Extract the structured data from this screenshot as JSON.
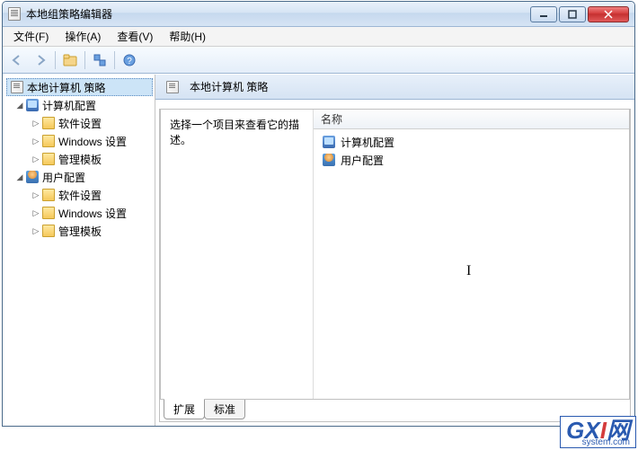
{
  "window_title": "本地组策略编辑器",
  "menus": {
    "file": "文件(F)",
    "action": "操作(A)",
    "view": "查看(V)",
    "help": "帮助(H)"
  },
  "tree": {
    "root": "本地计算机 策略",
    "computer": "计算机配置",
    "user": "用户配置",
    "software": "软件设置",
    "windows": "Windows 设置",
    "admin": "管理模板"
  },
  "header_title": "本地计算机 策略",
  "description_prompt": "选择一个项目来查看它的描述。",
  "list_header_name": "名称",
  "list_items": {
    "computer": "计算机配置",
    "user": "用户配置"
  },
  "tabs": {
    "extended": "扩展",
    "standard": "标准"
  },
  "watermark": {
    "brand_main": "GX",
    "brand_red": "I",
    "brand_suffix": "网",
    "domain": "system.com"
  }
}
